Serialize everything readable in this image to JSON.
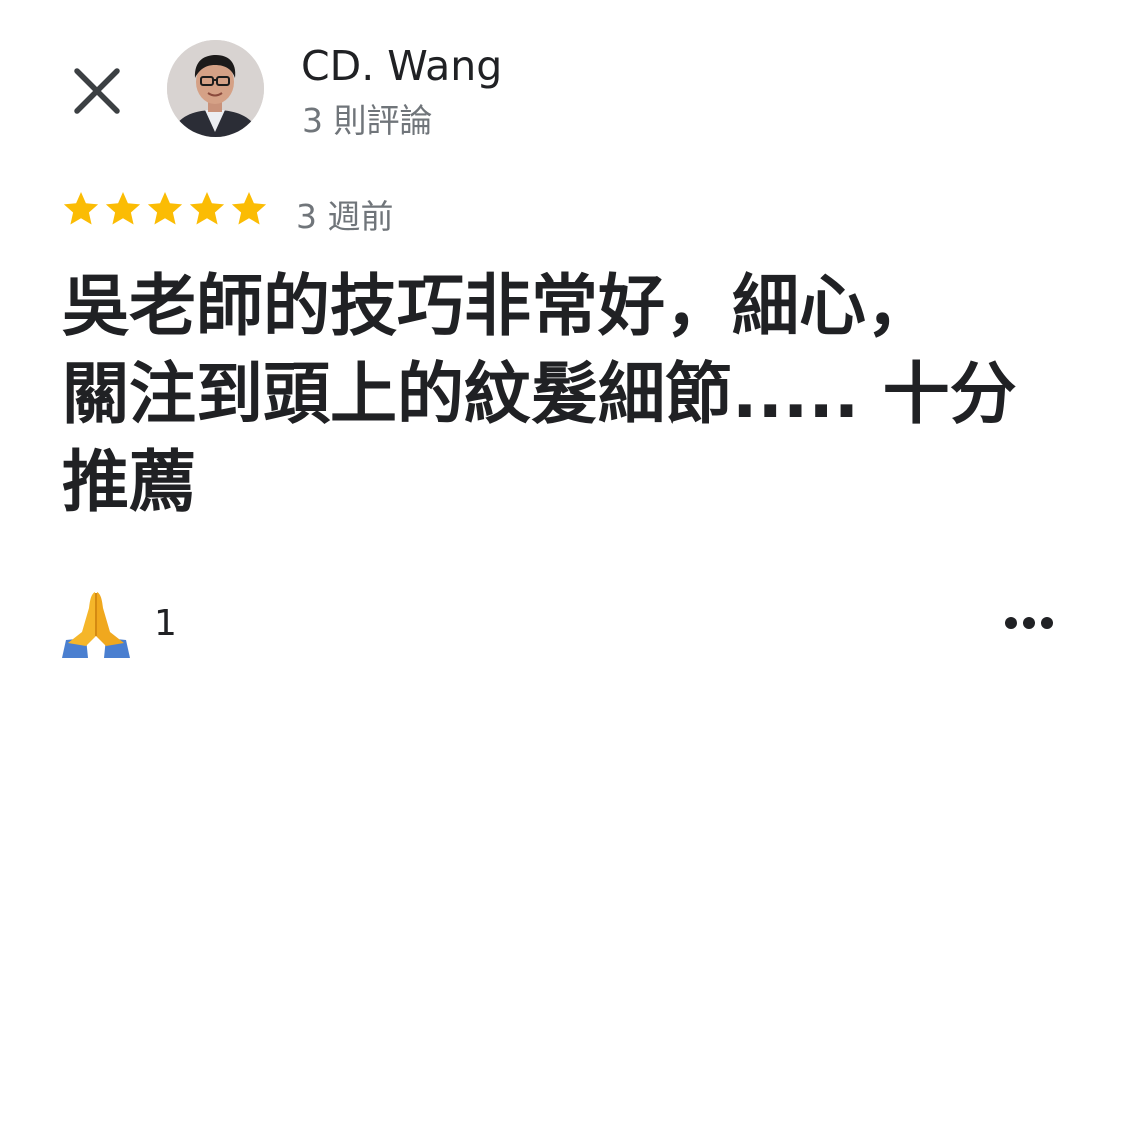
{
  "header": {
    "author_name": "CD. Wang",
    "review_count": "3 則評論",
    "close_icon": "close-icon",
    "avatar_icon": "profile-photo"
  },
  "review": {
    "rating": 5,
    "rating_max": 5,
    "star_color": "#fbbc04",
    "time": "3 週前",
    "text_lines": [
      "吳老師的技巧非常好，細心，",
      "關注到頭上的紋髮細節..... 十分",
      "推薦"
    ]
  },
  "reactions": {
    "emoji_icon": "folded-hands-icon",
    "count": "1"
  },
  "menu": {
    "more_icon": "more-horizontal-icon"
  }
}
